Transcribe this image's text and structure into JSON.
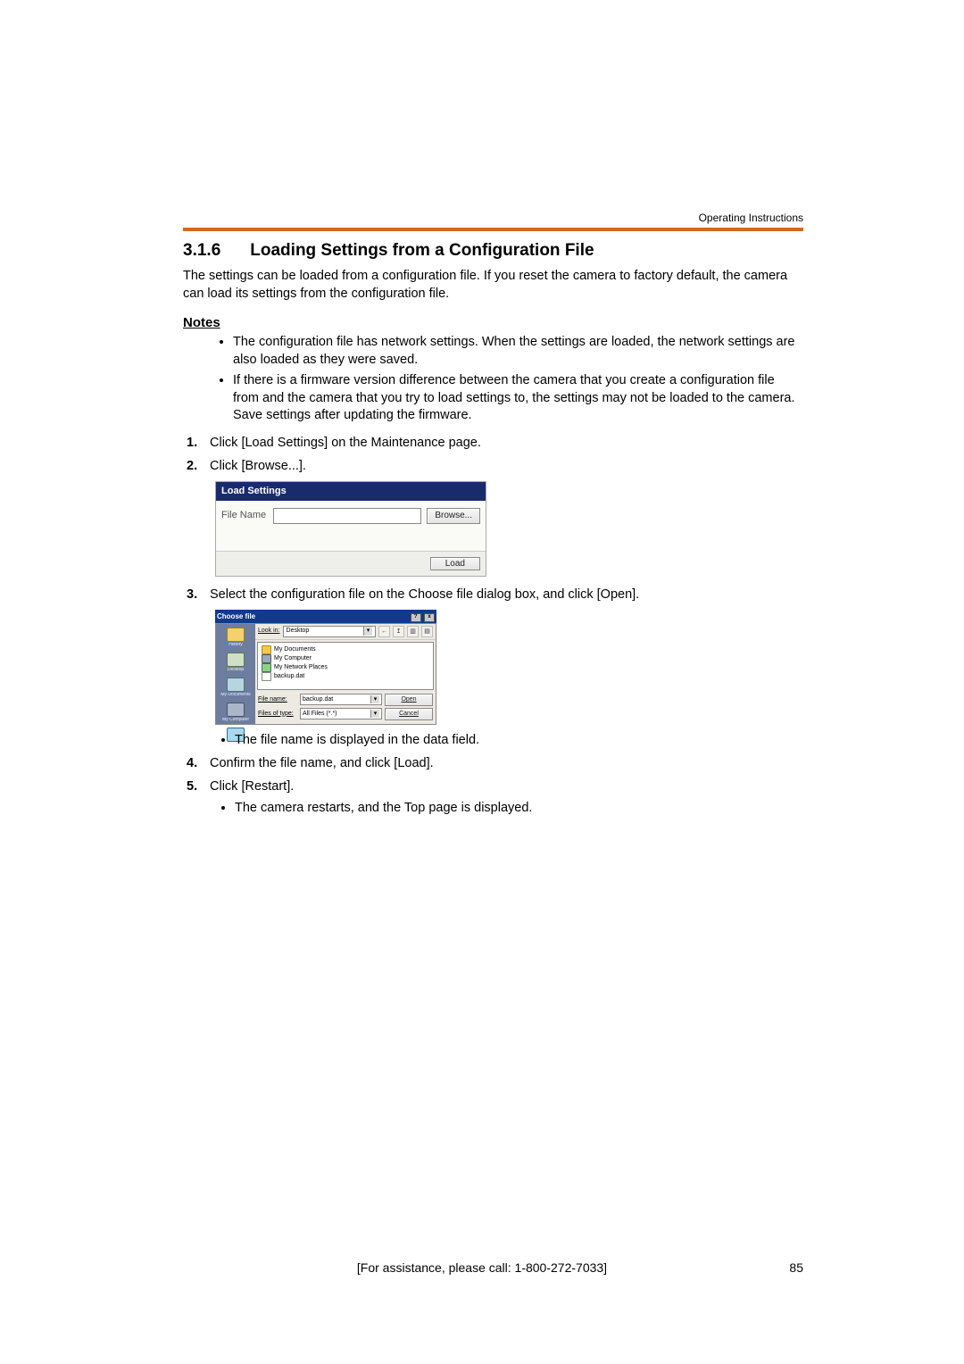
{
  "header": {
    "doc_label": "Operating Instructions"
  },
  "section": {
    "number": "3.1.6",
    "title": "Loading Settings from a Configuration File",
    "intro": "The settings can be loaded from a configuration file. If you reset the camera to factory default, the camera can load its settings from the configuration file."
  },
  "notes_heading": "Notes",
  "notes": [
    "The configuration file has network settings. When the settings are loaded, the network settings are also loaded as they were saved.",
    "If there is a firmware version difference between the camera that you create a configuration file from and the camera that you try to load settings to, the settings may not be loaded to the camera. Save settings after updating the firmware."
  ],
  "steps": {
    "s1": "Click [Load Settings] on the Maintenance page.",
    "s2": "Click [Browse...].",
    "s3": "Select the configuration file on the Choose file dialog box, and click [Open].",
    "s3_sub": "The file name is displayed in the data field.",
    "s4": "Confirm the file name, and click [Load].",
    "s5": "Click [Restart].",
    "s5_sub": "The camera restarts, and the Top page is displayed."
  },
  "load_panel": {
    "title": "Load Settings",
    "file_label": "File Name",
    "browse": "Browse...",
    "load": "Load"
  },
  "dialog": {
    "title": "Choose file",
    "lookin_label": "Look in:",
    "lookin_value": "Desktop",
    "tools": {
      "back": "←",
      "up": "↥",
      "new": "▥",
      "views": "▤"
    },
    "places": {
      "history": "History",
      "desktop": "Desktop",
      "mydocs": "My Documents",
      "mycomp": "My Computer",
      "mynet": "My Network P..."
    },
    "items": {
      "mydocs": "My Documents",
      "mycomp": "My Computer",
      "mynet": "My Network Places",
      "backup": "backup.dat"
    },
    "filename_label": "File name:",
    "filename_value": "backup.dat",
    "filetype_label": "Files of type:",
    "filetype_value": "All Files (*.*)",
    "open": "Open",
    "cancel": "Cancel"
  },
  "footer": {
    "assist": "[For assistance, please call: 1-800-272-7033]",
    "page": "85"
  }
}
